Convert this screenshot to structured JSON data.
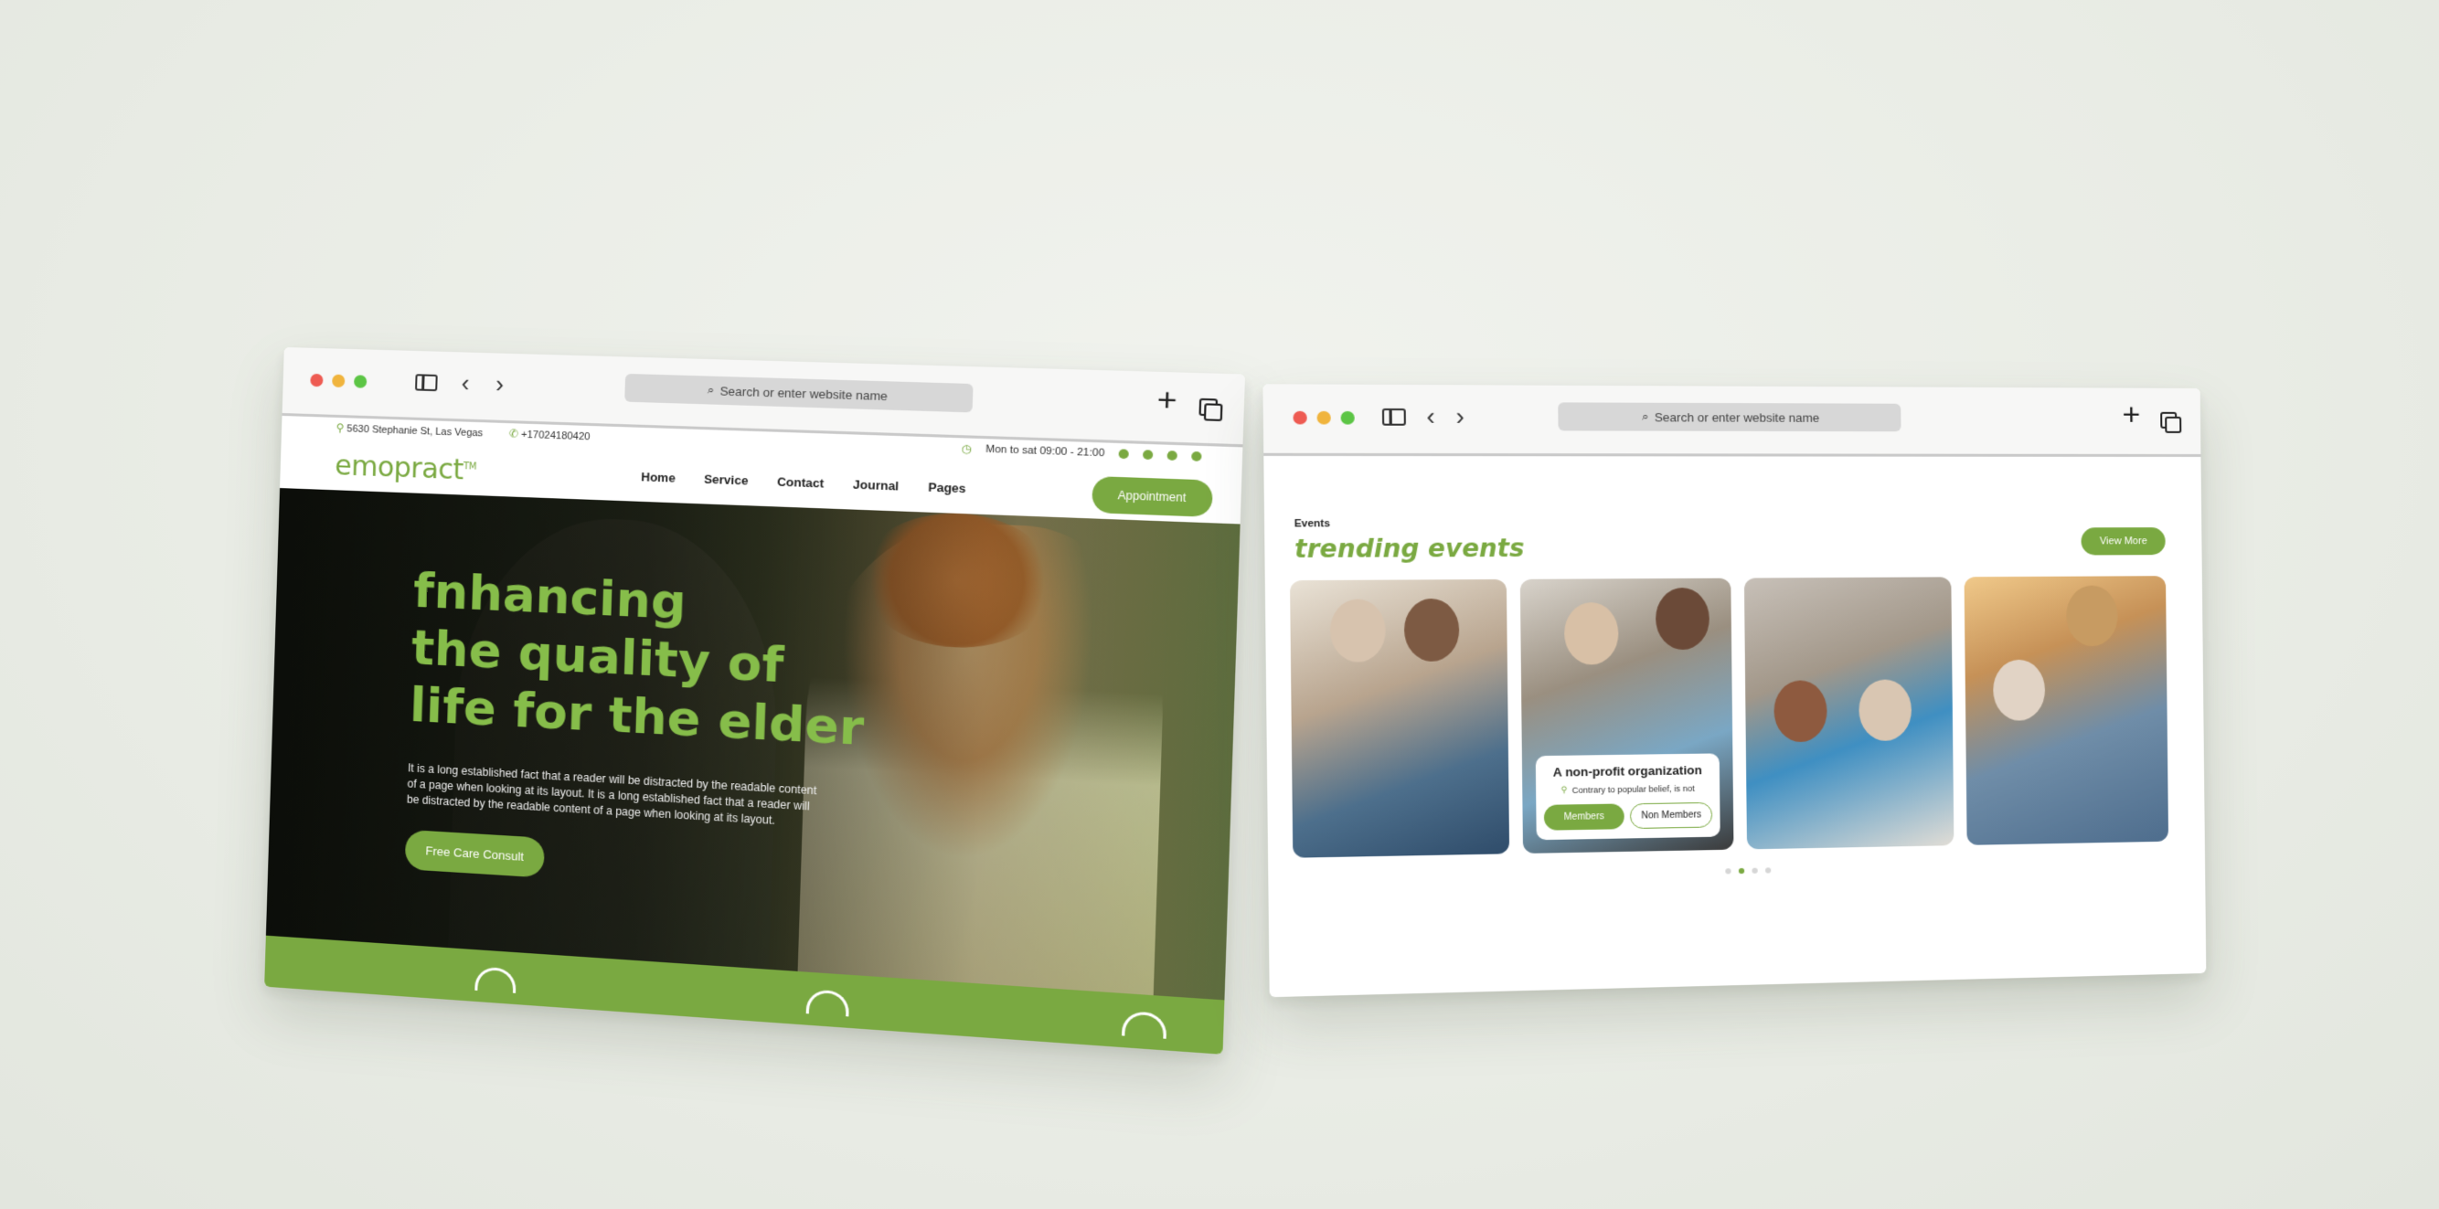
{
  "left_window": {
    "url_placeholder": "Search or enter website name",
    "topbar": {
      "address": "5630 Stephanie St, Las Vegas",
      "phone": "+17024180420",
      "hours": "Mon to sat 09:00 - 21:00"
    },
    "logo": "emopract",
    "logo_tm": "TM",
    "menu": [
      "Home",
      "Service",
      "Contact",
      "Journal",
      "Pages"
    ],
    "appointment_label": "Appointment",
    "hero": {
      "title_lines": [
        "fnhancing",
        "the quality of",
        "life for the elder"
      ],
      "description": "It is a long established fact that a reader will be distracted by the readable content of a page when looking at its layout. It is a long established fact that a reader will be distracted by the readable content of a page when looking at its layout.",
      "cta_label": "Free Care Consult"
    },
    "colors": {
      "accent": "#7aa941",
      "title": "#86bd4a"
    }
  },
  "right_window": {
    "url_placeholder": "Search or enter website name",
    "events_label": "Events",
    "events_title": "trending events",
    "view_more_label": "View More",
    "featured_card": {
      "title": "A non-profit organization",
      "subtitle": "Contrary to popular belief, is not",
      "members_label": "Members",
      "non_members_label": "Non Members"
    },
    "pager": {
      "count": 4,
      "active": 1
    }
  },
  "icons": [
    "search-icon",
    "sidebar-icon",
    "back-arrow-icon",
    "forward-arrow-icon",
    "new-tab-plus-icon",
    "tabs-overview-icon",
    "location-pin-icon",
    "phone-icon",
    "clock-icon",
    "social-icon",
    "house-heart-icon"
  ]
}
